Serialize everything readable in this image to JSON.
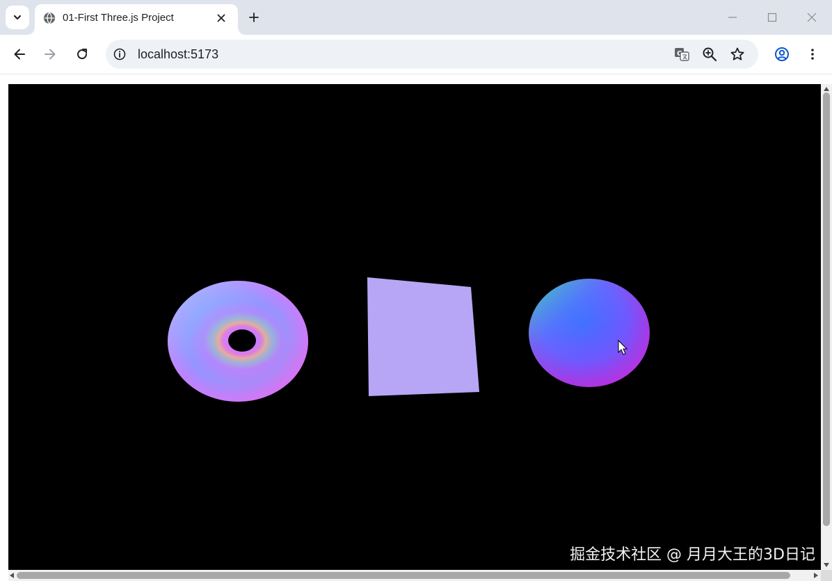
{
  "browser": {
    "tab": {
      "title": "01-First Three.js Project",
      "favicon": "globe-icon"
    },
    "address": {
      "url": "localhost:5173",
      "info_icon": "info-icon"
    },
    "icons": {
      "tab_search": "chevron-down-icon",
      "close_tab": "close-icon",
      "new_tab": "plus-icon",
      "minimize": "minimize-icon",
      "maximize": "maximize-icon",
      "close_window": "close-window-icon",
      "back": "back-arrow-icon",
      "forward": "forward-arrow-icon",
      "reload": "reload-icon",
      "translate": "translate-icon",
      "zoom": "zoom-icon",
      "bookmark": "star-icon",
      "profile": "profile-icon",
      "menu": "kebab-menu-icon"
    }
  },
  "page": {
    "background_color": "#000000",
    "objects": [
      {
        "kind": "torus",
        "material": "normal"
      },
      {
        "kind": "plane",
        "color": "#b7a6f5"
      },
      {
        "kind": "sphere",
        "material": "normal"
      }
    ],
    "watermark": "掘金技术社区 @ 月月大王的3D日记"
  },
  "colors": {
    "tabstrip_bg": "#dfe3eb",
    "omnibox_bg": "#eef1f6",
    "profile_accent": "#0b57d0"
  }
}
